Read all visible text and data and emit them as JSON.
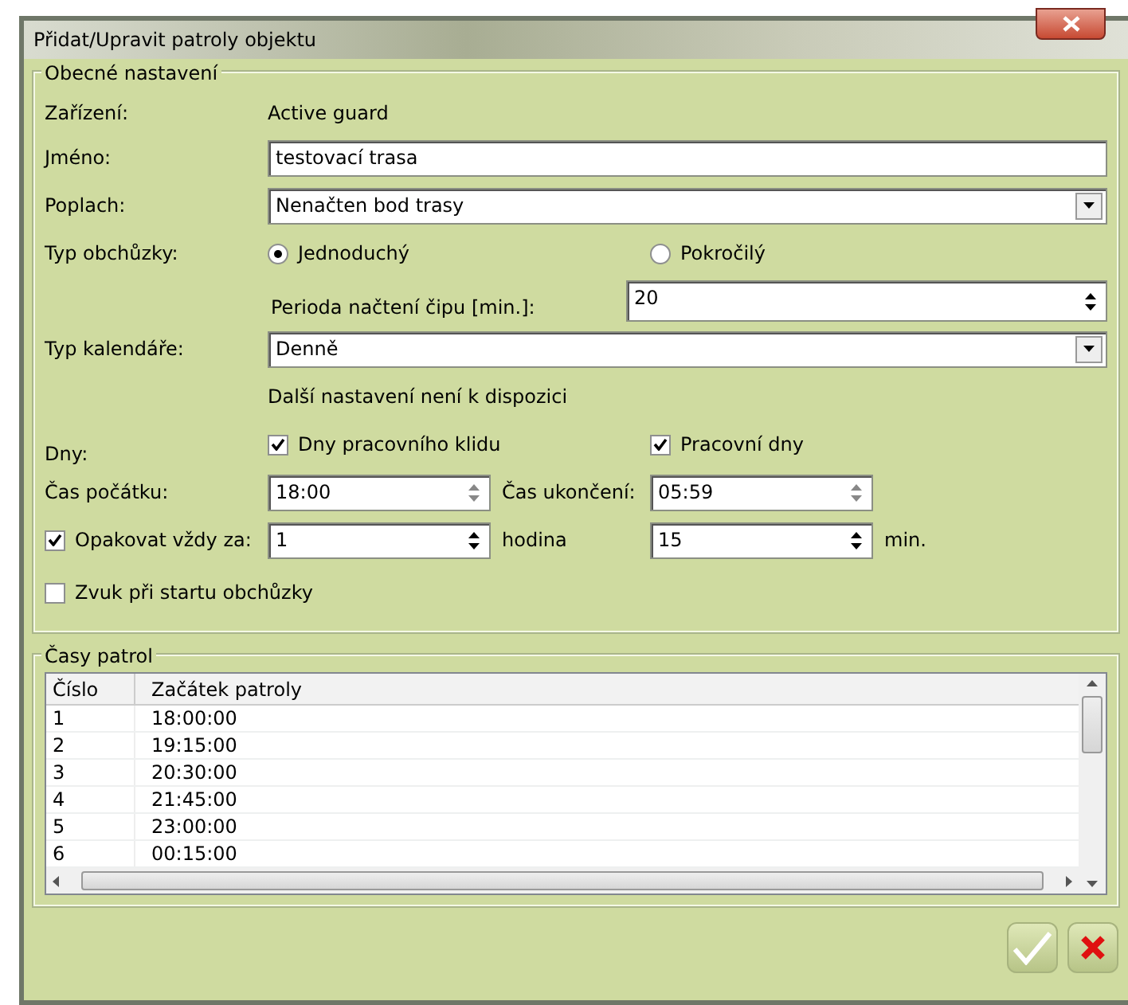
{
  "window": {
    "title": "Přidat/Upravit patroly objektu"
  },
  "general": {
    "legend": "Obecné nastavení",
    "device": {
      "label": "Zařízení:",
      "value": "Active guard"
    },
    "name": {
      "label": "Jméno:",
      "value": "testovací trasa"
    },
    "alarm": {
      "label": "Poplach:",
      "value": "Nenačten bod trasy"
    },
    "route_type": {
      "label": "Typ obchůzky:",
      "options": [
        {
          "label": "Jednoduchý",
          "selected": true
        },
        {
          "label": "Pokročilý",
          "selected": false
        }
      ]
    },
    "chip_period": {
      "label": "Perioda načtení čipu [min.]:",
      "value": "20"
    },
    "calendar_type": {
      "label": "Typ kalendáře:",
      "value": "Denně"
    },
    "note": "Další nastavení není k dispozici",
    "days": {
      "label": "Dny:",
      "options": [
        {
          "label": "Dny pracovního klidu",
          "checked": true
        },
        {
          "label": "Pracovní dny",
          "checked": true
        }
      ]
    },
    "start_time": {
      "label": "Čas počátku:",
      "value": "18:00"
    },
    "end_time": {
      "label": "Čas ukončení:",
      "value": "05:59"
    },
    "repeat": {
      "label": "Opakovat vždy za:",
      "checked": true,
      "hours": "1",
      "hours_unit": "hodina",
      "minutes": "15",
      "minutes_unit": "min."
    },
    "sound": {
      "label": "Zvuk při startu obchůzky",
      "checked": false
    }
  },
  "patrol_times": {
    "legend": "Časy patrol",
    "columns": [
      "Číslo",
      "Začátek patroly"
    ],
    "rows": [
      [
        "1",
        "18:00:00"
      ],
      [
        "2",
        "19:15:00"
      ],
      [
        "3",
        "20:30:00"
      ],
      [
        "4",
        "21:45:00"
      ],
      [
        "5",
        "23:00:00"
      ],
      [
        "6",
        "00:15:00"
      ]
    ]
  }
}
